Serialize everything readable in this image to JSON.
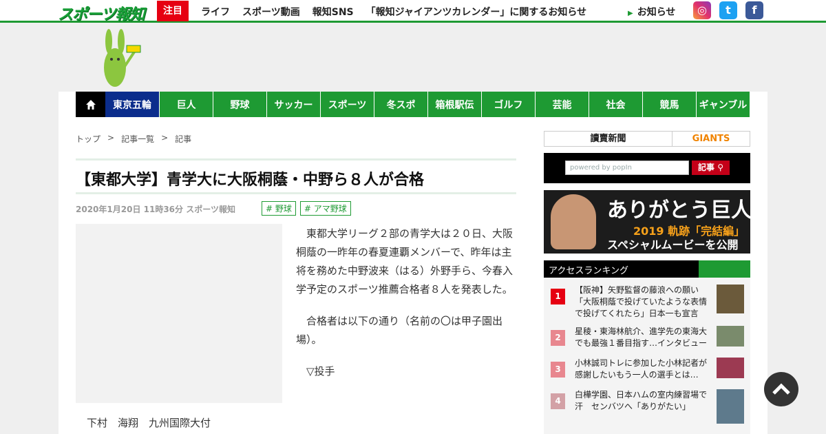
{
  "header": {
    "logo": "スポーツ報知",
    "hot_badge": "注目",
    "nav": [
      "ライフ",
      "スポーツ動画",
      "報知SNS",
      "「報知ジャイアンツカレンダー」に関するお知らせ"
    ],
    "notice": "お知らせ",
    "sns": [
      {
        "name": "instagram-icon",
        "glyph": "◎"
      },
      {
        "name": "twitter-icon",
        "glyph": "t"
      },
      {
        "name": "facebook-icon",
        "glyph": "f"
      }
    ]
  },
  "categories": [
    "東京五輪",
    "巨人",
    "野球",
    "サッカー",
    "スポーツ",
    "冬スポ",
    "箱根駅伝",
    "ゴルフ",
    "芸能",
    "社会",
    "競馬",
    "ギャンブル"
  ],
  "breadcrumb": [
    "トップ",
    ">",
    "記事一覧",
    ">",
    "記事"
  ],
  "article": {
    "title": "【東都大学】青学大に大阪桐蔭・中野ら８人が合格",
    "meta": "2020年1月20日 11時36分  スポーツ報知",
    "tags": [
      "# 野球",
      "# アマ野球"
    ],
    "paragraphs": [
      "東都大学リーグ２部の青学大は２０日、大阪桐蔭の一昨年の春夏連覇メンバーで、昨年は主将を務めた中野波来（はる）外野手ら、今春入学予定のスポーツ推薦合格者８人を発表した。",
      "合格者は以下の通り（名前の〇は甲子園出場）。",
      "▽投手"
    ],
    "lower_line": "下村　海翔　九州国際大付"
  },
  "sidebar": {
    "yomiuri": "讀賣新聞",
    "giants": "GIANTS",
    "search_placeholder": "powered by popIn",
    "search_button": "記事",
    "banner": {
      "line1": "ありがとう巨人",
      "line2": "2019 軌跡「完結編」",
      "line3": "スペシャルムービーを公開"
    },
    "ranking_title": "アクセスランキング",
    "ranking": [
      {
        "num": "1",
        "text": "【阪神】矢野監督の藤浪への願い「大阪桐蔭で投げていたような表情で投げてくれたら」日本一も宣言",
        "color": "#e60012"
      },
      {
        "num": "2",
        "text": "星稜・東海林航介、進学先の東海大でも最強１番目指す…インタビュー",
        "color": "#e8878f"
      },
      {
        "num": "3",
        "text": "小林誠司トレに参加した小林記者が感謝したいもう一人の選手とは…",
        "color": "#e8878f"
      },
      {
        "num": "4",
        "text": "白樺学園、日本ハムの室内練習場で汗　センバツへ「ありがたい」",
        "color": "#d3a1a6"
      }
    ]
  },
  "to_top": "chevron-up-icon"
}
